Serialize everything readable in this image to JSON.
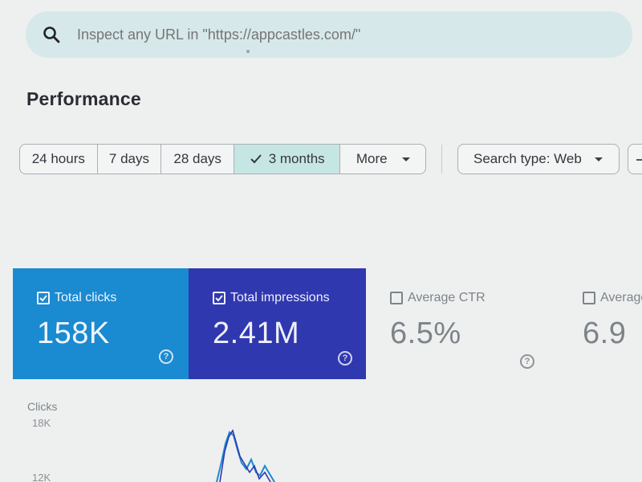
{
  "search": {
    "placeholder": "Inspect any URL in \"https://appcastles.com/\"",
    "icon": "search-icon"
  },
  "page": {
    "title": "Performance"
  },
  "date_range": {
    "options": [
      "24 hours",
      "7 days",
      "28 days",
      "3 months",
      "More"
    ],
    "selected": "3 months"
  },
  "filters": {
    "search_type_label": "Search type: Web"
  },
  "metrics": {
    "clicks": {
      "label": "Total clicks",
      "value": "158K",
      "checked": true,
      "color": "#1a8ad1"
    },
    "impressions": {
      "label": "Total impressions",
      "value": "2.41M",
      "checked": true,
      "color": "#3038b0"
    },
    "ctr": {
      "label": "Average CTR",
      "value": "6.5%",
      "checked": false
    },
    "position": {
      "label": "Average p",
      "value": "6.9",
      "checked": false
    }
  },
  "chart": {
    "ylabel": "Clicks",
    "ticks": [
      "18K",
      "12K"
    ]
  },
  "colors": {
    "selected_range_bg": "#c6e6e3",
    "search_bar_bg": "#d7e8ea"
  }
}
